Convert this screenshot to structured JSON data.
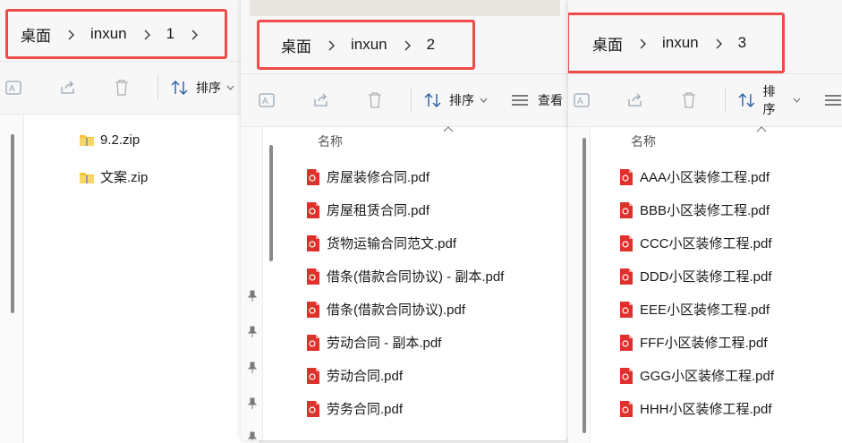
{
  "accent_color": "#ef4b4b",
  "pdf_icon_color": "#e0302c",
  "zip_icon_color": "#f2c43b",
  "windows": [
    {
      "breadcrumb": [
        "桌面",
        "inxun",
        "1"
      ],
      "toolbar": {
        "sort_label": "排序"
      },
      "files": [
        "9.2.zip",
        "文案.zip"
      ]
    },
    {
      "breadcrumb": [
        "桌面",
        "inxun",
        "2"
      ],
      "toolbar": {
        "sort_label": "排序",
        "view_label": "查看"
      },
      "column_header": "名称",
      "files": [
        "房屋装修合同.pdf",
        "房屋租赁合同.pdf",
        "货物运输合同范文.pdf",
        "借条(借款合同协议) - 副本.pdf",
        "借条(借款合同协议).pdf",
        "劳动合同 - 副本.pdf",
        "劳动合同.pdf",
        "劳务合同.pdf"
      ]
    },
    {
      "breadcrumb": [
        "桌面",
        "inxun",
        "3"
      ],
      "toolbar": {
        "sort_label": "排序"
      },
      "column_header": "名称",
      "files": [
        "AAA小区装修工程.pdf",
        "BBB小区装修工程.pdf",
        "CCC小区装修工程.pdf",
        "DDD小区装修工程.pdf",
        "EEE小区装修工程.pdf",
        "FFF小区装修工程.pdf",
        "GGG小区装修工程.pdf",
        "HHH小区装修工程.pdf"
      ]
    }
  ]
}
